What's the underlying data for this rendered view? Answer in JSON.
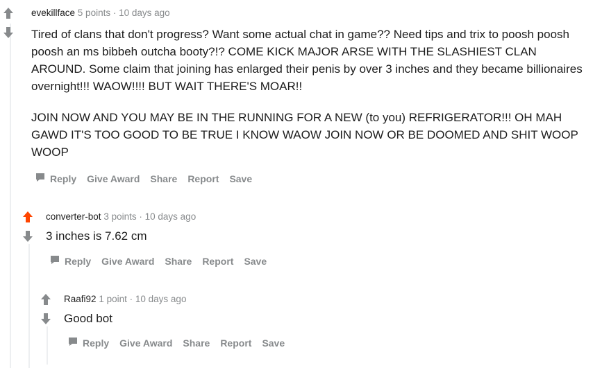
{
  "colors": {
    "upvote_active": "#ff4500",
    "vote_inactive": "#878a8c",
    "thread_line": "#edeff1",
    "meta_text": "#878a8c",
    "body_text": "#1c1c1c"
  },
  "comments": [
    {
      "author": "evekillface",
      "points": "5 points",
      "separator": "·",
      "time": "10 days ago",
      "paragraphs": [
        "Tired of clans that don't progress? Want some actual chat in game?? Need tips and trix to poosh poosh poosh an ms bibbeh outcha booty?!? COME KICK MAJOR ARSE WITH THE SLASHIEST CLAN AROUND. Some claim that joining has enlarged their penis by over 3 inches and they became billionaires overnight!!! WAOW!!!! BUT WAIT THERE'S MOAR!!",
        "JOIN NOW AND YOU MAY BE IN THE RUNNING FOR A NEW (to you) REFRIGERATOR!!! OH MAH GAWD IT'S TOO GOOD TO BE TRUE I KNOW WAOW JOIN NOW OR BE DOOMED AND SHIT WOOP WOOP"
      ],
      "upvoted": false
    },
    {
      "author": "converter-bot",
      "points": "3 points",
      "separator": "·",
      "time": "10 days ago",
      "paragraphs": [
        "3 inches is 7.62 cm"
      ],
      "upvoted": true
    },
    {
      "author": "Raafi92",
      "points": "1 point",
      "separator": "·",
      "time": "10 days ago",
      "paragraphs": [
        "Good bot"
      ],
      "upvoted": false
    }
  ],
  "actions": {
    "reply": "Reply",
    "give_award": "Give Award",
    "share": "Share",
    "report": "Report",
    "save": "Save"
  },
  "icons": {
    "upvote": "upvote-arrow-icon",
    "downvote": "downvote-arrow-icon",
    "reply": "speech-bubble-icon"
  }
}
